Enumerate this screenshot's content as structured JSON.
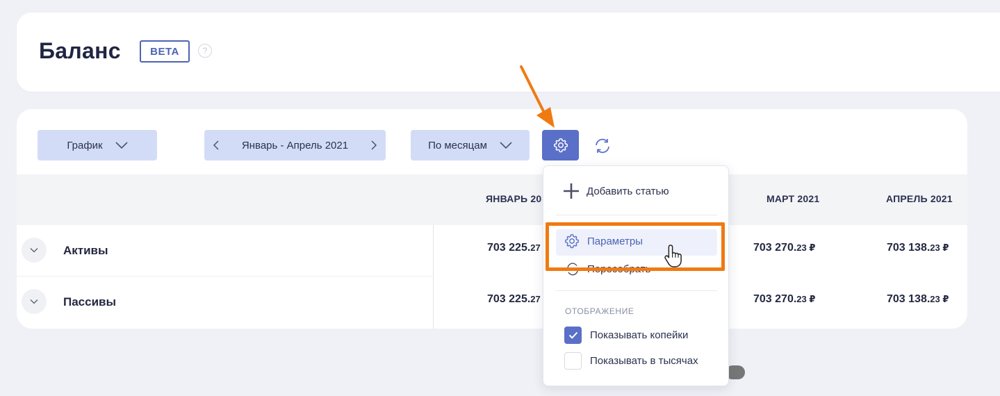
{
  "header": {
    "title": "Баланс",
    "badge": "BETA",
    "help_glyph": "?"
  },
  "toolbar": {
    "view_select": "График",
    "period": "Январь - Апрель 2021",
    "grouping": "По месяцам",
    "settings_icon": "gear-icon",
    "refresh_icon": "refresh-icon"
  },
  "table": {
    "columns": [
      "ЯНВАРЬ 20",
      "МАРТ 2021",
      "АПРЕЛЬ 2021"
    ],
    "rows": [
      {
        "label": "Активы",
        "values": [
          {
            "main": "703 225.",
            "cents": "27"
          },
          {
            "main": "703 270.",
            "cents": "23 ₽"
          },
          {
            "main": "703 138.",
            "cents": "23 ₽"
          }
        ]
      },
      {
        "label": "Пассивы",
        "values": [
          {
            "main": "703 225.",
            "cents": "27"
          },
          {
            "main": "703 270.",
            "cents": "23 ₽"
          },
          {
            "main": "703 138.",
            "cents": "23 ₽"
          }
        ]
      }
    ]
  },
  "dropdown": {
    "add_article": "Добавить статью",
    "parameters": "Параметры",
    "rebuild": "Пересобрать",
    "section_display": "ОТОБРАЖЕНИЕ",
    "show_kopecks": "Показывать копейки",
    "show_kopecks_checked": true,
    "show_thousands": "Показывать в тысячах",
    "show_thousands_checked": false
  },
  "colors": {
    "accent": "#5a6fc7",
    "button_bg": "#d3dcf7",
    "annotation": "#f07a12"
  }
}
